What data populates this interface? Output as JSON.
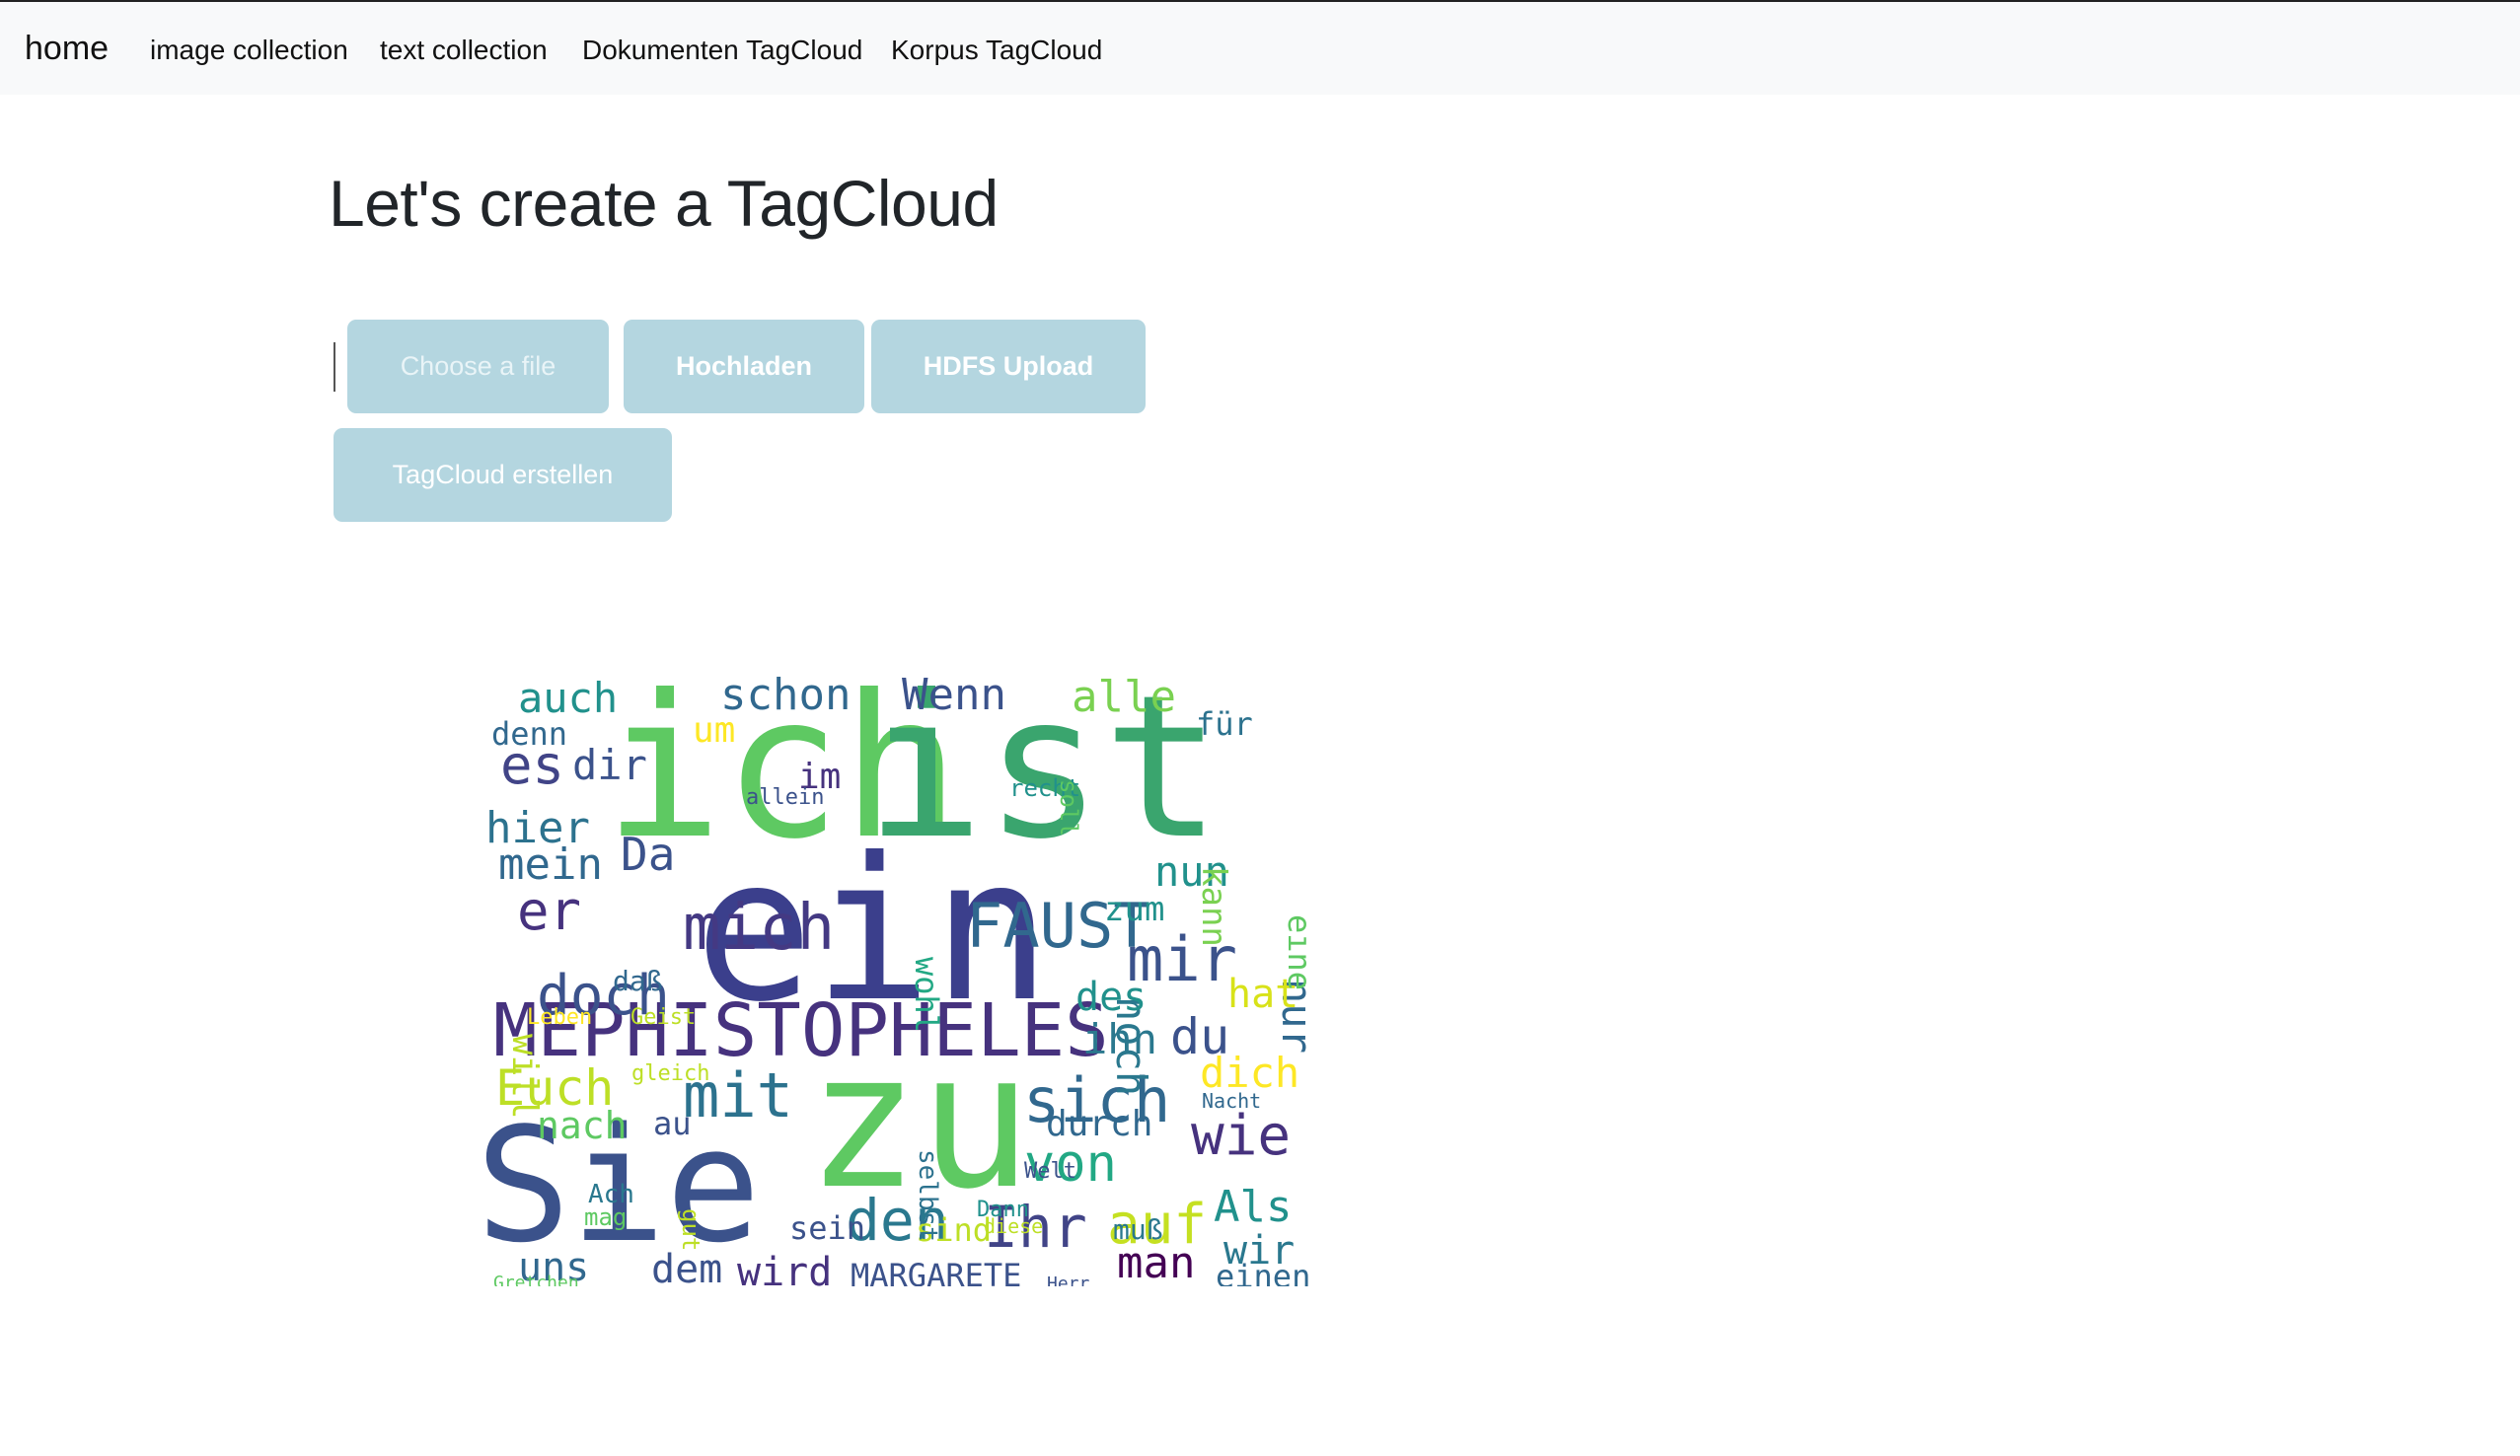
{
  "navbar": {
    "brand": "home",
    "links": [
      "image collection",
      "text collection",
      "Dokumenten TagCloud",
      "Korpus TagCloud"
    ]
  },
  "page": {
    "title": "Let's create a TagCloud"
  },
  "buttons": {
    "choose_file": "Choose a file",
    "upload": "Hochladen",
    "hdfs_upload": "HDFS Upload",
    "create": "TagCloud erstellen"
  },
  "colors": {
    "button_bg": "#b4d6e0",
    "navbar_bg": "#f8f9fa",
    "cloud_palette": [
      "#440154",
      "#3b528b",
      "#21918c",
      "#5ec962",
      "#fde725"
    ]
  },
  "tagcloud": {
    "words": [
      {
        "text": "ich",
        "color": "#5ec962"
      },
      {
        "text": "ist",
        "color": "#3aa56e"
      },
      {
        "text": "ein",
        "color": "#3b3f8c"
      },
      {
        "text": "zu",
        "color": "#5ec962"
      },
      {
        "text": "Sie",
        "color": "#3b528b"
      },
      {
        "text": "MEPHISTOPHELES",
        "color": "#46327e"
      },
      {
        "text": "FAUST",
        "color": "#31688e"
      },
      {
        "text": "mich",
        "color": "#443983"
      },
      {
        "text": "mir",
        "color": "#3b528b"
      },
      {
        "text": "sich",
        "color": "#31688e"
      },
      {
        "text": "mit",
        "color": "#2c728e"
      },
      {
        "text": "den",
        "color": "#2a788e"
      },
      {
        "text": "Ihr",
        "color": "#414487"
      },
      {
        "text": "auf",
        "color": "#c5e021"
      },
      {
        "text": "wie",
        "color": "#46327e"
      },
      {
        "text": "doch",
        "color": "#3b528b"
      },
      {
        "text": "schon",
        "color": "#31688e"
      },
      {
        "text": "Wenn",
        "color": "#3b528b"
      },
      {
        "text": "alle",
        "color": "#7ad151"
      },
      {
        "text": "auch",
        "color": "#21918c"
      },
      {
        "text": "es",
        "color": "#414487"
      },
      {
        "text": "dir",
        "color": "#3b528b"
      },
      {
        "text": "hier",
        "color": "#2c728e"
      },
      {
        "text": "mein",
        "color": "#31688e"
      },
      {
        "text": "er",
        "color": "#46327e"
      },
      {
        "text": "Da",
        "color": "#3b528b"
      },
      {
        "text": "nun",
        "color": "#21918c"
      },
      {
        "text": "nur",
        "color": "#31688e"
      },
      {
        "text": "noch",
        "color": "#2a788e"
      },
      {
        "text": "des",
        "color": "#21918c"
      },
      {
        "text": "du",
        "color": "#3b528b"
      },
      {
        "text": "ihn",
        "color": "#2a788e"
      },
      {
        "text": "dich",
        "color": "#fde725"
      },
      {
        "text": "hat",
        "color": "#d8e219"
      },
      {
        "text": "Euch",
        "color": "#bddf26"
      },
      {
        "text": "nach",
        "color": "#5ec962"
      },
      {
        "text": "von",
        "color": "#22a884"
      },
      {
        "text": "durch",
        "color": "#31688e"
      },
      {
        "text": "Als",
        "color": "#21918c"
      },
      {
        "text": "wir",
        "color": "#2a788e"
      },
      {
        "text": "man",
        "color": "#440154"
      },
      {
        "text": "einen",
        "color": "#31688e"
      },
      {
        "text": "wird",
        "color": "#46327e"
      },
      {
        "text": "dem",
        "color": "#3b528b"
      },
      {
        "text": "uns",
        "color": "#31688e"
      },
      {
        "text": "MARGARETE",
        "color": "#3b528b"
      },
      {
        "text": "sein",
        "color": "#3b528b"
      },
      {
        "text": "sind",
        "color": "#bddf26"
      },
      {
        "text": "muß",
        "color": "#2a788e"
      },
      {
        "text": "um",
        "color": "#fde725"
      },
      {
        "text": "denn",
        "color": "#31688e"
      },
      {
        "text": "im",
        "color": "#46327e"
      },
      {
        "text": "recht",
        "color": "#21918c"
      },
      {
        "text": "kann",
        "color": "#7ad151"
      },
      {
        "text": "für",
        "color": "#2c728e"
      },
      {
        "text": "eine",
        "color": "#5ec962"
      },
      {
        "text": "zum",
        "color": "#21918c"
      },
      {
        "text": "wohl",
        "color": "#22a884"
      },
      {
        "text": "will",
        "color": "#bddf26"
      },
      {
        "text": "daß",
        "color": "#31688e"
      },
      {
        "text": "Leben",
        "color": "#fde725"
      },
      {
        "text": "Geist",
        "color": "#bddf26"
      },
      {
        "text": "allein",
        "color": "#3b528b"
      },
      {
        "text": "soll",
        "color": "#5ec962"
      },
      {
        "text": "selbst",
        "color": "#2c728e"
      },
      {
        "text": "gleich",
        "color": "#bddf26"
      },
      {
        "text": "Welt",
        "color": "#3b528b"
      },
      {
        "text": "au",
        "color": "#3b528b"
      },
      {
        "text": "Ach",
        "color": "#2a788e"
      },
      {
        "text": "mag",
        "color": "#5ec962"
      },
      {
        "text": "gut",
        "color": "#bddf26"
      },
      {
        "text": "Dann",
        "color": "#21918c"
      },
      {
        "text": "diese",
        "color": "#bddf26"
      },
      {
        "text": "Gretchen",
        "color": "#5ec962"
      },
      {
        "text": "Herr",
        "color": "#3b528b"
      },
      {
        "text": "Nacht",
        "color": "#31688e"
      }
    ]
  }
}
